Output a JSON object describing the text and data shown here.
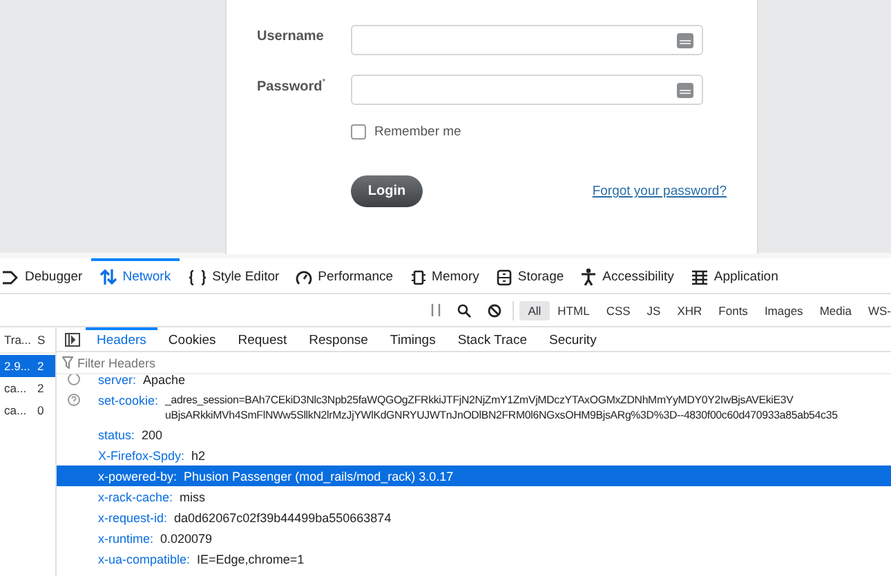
{
  "login": {
    "fields": [
      {
        "label": "Username"
      },
      {
        "label": "Password$^{*}$"
      }
    ],
    "remember": {
      "label": "Remember me",
      "checked": false
    },
    "login_button": "Login",
    "forgot_link": "Forgot your password?"
  },
  "devtools": {
    "tools": [
      {
        "label": "Debugger",
        "selected": false
      },
      {
        "label": "Network",
        "selected": true
      },
      {
        "label": "Style Editor",
        "selected": false
      },
      {
        "label": "Performance",
        "selected": false
      },
      {
        "label": "Memory",
        "selected": false
      },
      {
        "label": "Storage",
        "selected": false
      },
      {
        "label": "Accessibility",
        "selected": false
      },
      {
        "label": "Application",
        "selected": false
      }
    ],
    "filter_buttons": [
      {
        "label": "All",
        "selected": true
      },
      {
        "label": "HTML",
        "selected": false
      },
      {
        "label": "CSS",
        "selected": false
      },
      {
        "label": "JS",
        "selected": false
      },
      {
        "label": "XHR",
        "selected": false
      },
      {
        "label": "Fonts",
        "selected": false
      },
      {
        "label": "Images",
        "selected": false
      },
      {
        "label": "Media",
        "selected": false
      },
      {
        "label": "WS-",
        "selected": false
      }
    ],
    "request_list": {
      "columns": [
        "Tra...",
        "S"
      ],
      "rows": [
        {
          "cells": [
            "2.9...",
            "2"
          ],
          "selected": true
        },
        {
          "cells": [
            "ca...",
            "2"
          ],
          "selected": false
        },
        {
          "cells": [
            "ca...",
            "0"
          ],
          "selected": false
        }
      ]
    },
    "detail_tabs": [
      {
        "label": "Headers",
        "selected": true
      },
      {
        "label": "Cookies",
        "selected": false
      },
      {
        "label": "Request",
        "selected": false
      },
      {
        "label": "Response",
        "selected": false
      },
      {
        "label": "Timings",
        "selected": false
      },
      {
        "label": "Stack Trace",
        "selected": false
      },
      {
        "label": "Security",
        "selected": false
      }
    ],
    "filter_placeholder": "Filter Headers",
    "headers": [
      {
        "name": "server:",
        "value_lines": [
          "Apache"
        ],
        "selected": false
      },
      {
        "name": "set-cookie:",
        "value_lines": [
          "_adres_session=BAh7CEkiD3Nlc3Npb25faWQGOgZFRkkiJTFjN2NjZmY1ZmVjMDczYTAxOGMxZDNhMmYyMDY0Y2IwBjsAVEkiE3V",
          "uBjsARkkiMVh4SmFlNWw5SllkN2lrMzJjYWlKdGNRYUJWTnJnODlBN2FRM0l6NGxsOHM9BjsARg%3D%3D--4830f00c60d470933a85ab54c35"
        ],
        "selected": false
      },
      {
        "name": "status:",
        "value_lines": [
          "200"
        ],
        "selected": false
      },
      {
        "name": "X-Firefox-Spdy:",
        "value_lines": [
          "h2"
        ],
        "selected": false
      },
      {
        "name": "x-powered-by:",
        "value_lines": [
          "Phusion Passenger (mod_rails/mod_rack) 3.0.17"
        ],
        "selected": true
      },
      {
        "name": "x-rack-cache:",
        "value_lines": [
          "miss"
        ],
        "selected": false
      },
      {
        "name": "x-request-id:",
        "value_lines": [
          "da0d62067c02f39b44499ba550663874"
        ],
        "selected": false
      },
      {
        "name": "x-runtime:",
        "value_lines": [
          "0.020079"
        ],
        "selected": false
      },
      {
        "name": "x-ua-compatible:",
        "value_lines": [
          "IE=Edge,chrome=1"
        ],
        "selected": false
      }
    ]
  }
}
